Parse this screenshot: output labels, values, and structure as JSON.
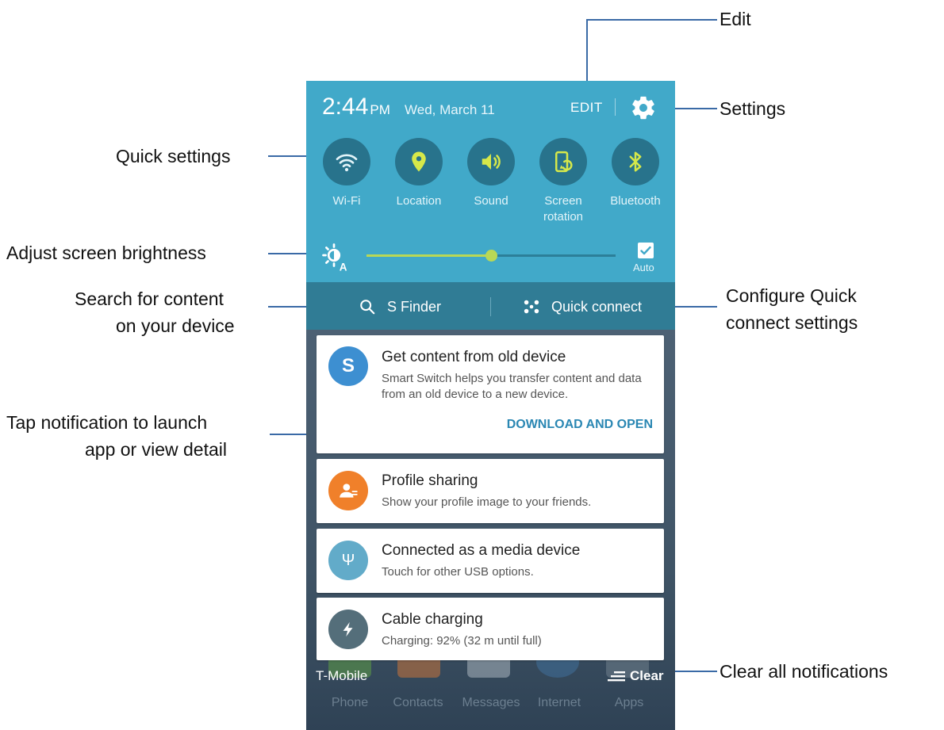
{
  "callouts": {
    "edit": "Edit",
    "settings": "Settings",
    "quick_settings": "Quick settings",
    "brightness": "Adjust screen brightness",
    "search_line1": "Search for content",
    "search_line2": "on your device",
    "quick_connect_line1": "Configure Quick",
    "quick_connect_line2": "connect settings",
    "tap_line1": "Tap notification to launch",
    "tap_line2": "app or view detail",
    "clear": "Clear all notifications"
  },
  "status": {
    "time": "2:44",
    "ampm": "PM",
    "date": "Wed, March 11",
    "edit_label": "EDIT",
    "settings_icon": "gear-icon"
  },
  "quick_settings": [
    {
      "label": "Wi-Fi",
      "icon": "wifi-icon"
    },
    {
      "label": "Location",
      "icon": "location-icon"
    },
    {
      "label": "Sound",
      "icon": "sound-icon"
    },
    {
      "label": "Screen rotation",
      "icon": "screen-rotation-icon"
    },
    {
      "label": "Bluetooth",
      "icon": "bluetooth-icon"
    }
  ],
  "brightness": {
    "level": 0.5,
    "auto_label": "Auto",
    "auto_checked": true
  },
  "finder_bar": {
    "s_finder": "S Finder",
    "quick_connect": "Quick connect"
  },
  "notifications": [
    {
      "title": "Get content from old device",
      "desc": "Smart Switch helps you transfer content and data from an old device to a new device.",
      "action": "DOWNLOAD AND OPEN",
      "icon": "smart-switch-icon",
      "icon_text": "S",
      "color": "#3d8fd1"
    },
    {
      "title": "Profile sharing",
      "desc": "Show your profile image to your friends.",
      "icon": "profile-share-icon",
      "color": "#f0802a"
    },
    {
      "title": "Connected as a media device",
      "desc": "Touch for other USB options.",
      "icon": "usb-icon",
      "color": "#62abc9"
    },
    {
      "title": "Cable charging",
      "desc": "Charging: 92% (32 m until full)",
      "icon": "charging-icon",
      "color": "#546e7a"
    }
  ],
  "footer": {
    "carrier": "T-Mobile",
    "clear_label": "Clear"
  },
  "dock": [
    "Phone",
    "Contacts",
    "Messages",
    "Internet",
    "Apps"
  ],
  "colors": {
    "panel": "#41a9c9",
    "finder_bar": "#307c95",
    "toggle_bg": "#28738c",
    "accent": "#d6e84a",
    "callout_line": "#3a6aa6"
  }
}
